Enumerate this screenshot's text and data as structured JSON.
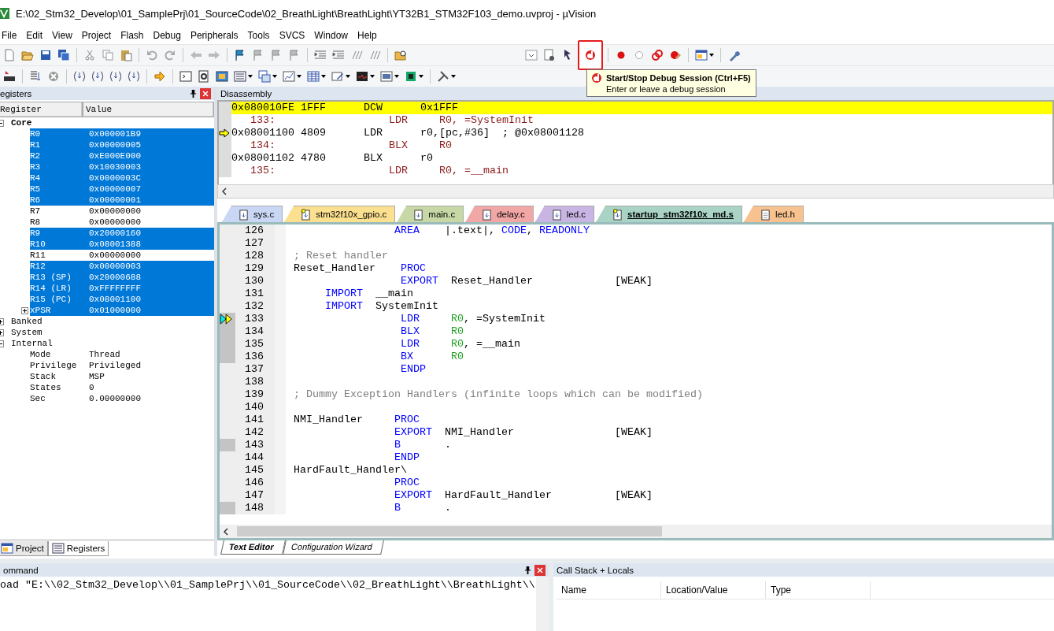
{
  "window": {
    "title": "E:\\02_Stm32_Develop\\01_SamplePrj\\01_SourceCode\\02_BreathLight\\BreathLight\\YT32B1_STM32F103_demo.uvproj - µVision"
  },
  "menu": [
    "File",
    "Edit",
    "View",
    "Project",
    "Flash",
    "Debug",
    "Peripherals",
    "Tools",
    "SVCS",
    "Window",
    "Help"
  ],
  "tooltip": {
    "title": "Start/Stop Debug Session (Ctrl+F5)",
    "text": "Enter or leave a debug session"
  },
  "registers": {
    "title": "egisters",
    "columns": [
      "Register",
      "Value"
    ],
    "tree": [
      {
        "name": "Core",
        "expanded": true,
        "children": [
          {
            "name": "R0",
            "value": "0x000001B9",
            "selected": true
          },
          {
            "name": "R1",
            "value": "0x00000005",
            "selected": true
          },
          {
            "name": "R2",
            "value": "0xE000E000",
            "selected": true
          },
          {
            "name": "R3",
            "value": "0x10030003",
            "selected": true
          },
          {
            "name": "R4",
            "value": "0x0000003C",
            "selected": true
          },
          {
            "name": "R5",
            "value": "0x00000007",
            "selected": true
          },
          {
            "name": "R6",
            "value": "0x00000001",
            "selected": true
          },
          {
            "name": "R7",
            "value": "0x00000000",
            "selected": false
          },
          {
            "name": "R8",
            "value": "0x00000000",
            "selected": false
          },
          {
            "name": "R9",
            "value": "0x20000160",
            "selected": true
          },
          {
            "name": "R10",
            "value": "0x08001388",
            "selected": true
          },
          {
            "name": "R11",
            "value": "0x00000000",
            "selected": false
          },
          {
            "name": "R12",
            "value": "0x00000003",
            "selected": true
          },
          {
            "name": "R13 (SP)",
            "value": "0x20000688",
            "selected": true
          },
          {
            "name": "R14 (LR)",
            "value": "0xFFFFFFFF",
            "selected": true
          },
          {
            "name": "R15 (PC)",
            "value": "0x08001100",
            "selected": true
          },
          {
            "name": "xPSR",
            "value": "0x01000000",
            "selected": true,
            "expanded": false
          }
        ]
      },
      {
        "name": "Banked",
        "expanded": false
      },
      {
        "name": "System",
        "expanded": false
      },
      {
        "name": "Internal",
        "expanded": true,
        "children": [
          {
            "name": "Mode",
            "value": "Thread",
            "selected": false
          },
          {
            "name": "Privilege",
            "value": "Privileged",
            "selected": false
          },
          {
            "name": "Stack",
            "value": "MSP",
            "selected": false
          },
          {
            "name": "States",
            "value": "0",
            "selected": false
          },
          {
            "name": "Sec",
            "value": "0.00000000",
            "selected": false
          }
        ]
      }
    ]
  },
  "left_tabs": [
    {
      "label": "Project",
      "selected": false
    },
    {
      "label": "Registers",
      "selected": true
    }
  ],
  "disassembly": {
    "title": "Disassembly",
    "rows": [
      {
        "kind": "instruction",
        "text": "0x080010FE 1FFF      DCW      0x1FFF",
        "highlighted": true,
        "current": false
      },
      {
        "kind": "source",
        "text": "   133:                  LDR     R0, =SystemInit",
        "highlighted": false,
        "current": false
      },
      {
        "kind": "instruction",
        "text": "0x08001100 4809      LDR      r0,[pc,#36]  ; @0x08001128",
        "highlighted": false,
        "current": true
      },
      {
        "kind": "source",
        "text": "   134:                  BLX     R0",
        "highlighted": false,
        "current": false
      },
      {
        "kind": "instruction",
        "text": "0x08001102 4780      BLX      r0",
        "highlighted": false,
        "current": false
      },
      {
        "kind": "source",
        "text": "   135:                  LDR     R0, =__main",
        "highlighted": false,
        "current": false
      }
    ]
  },
  "file_tabs": [
    {
      "label": "sys.c",
      "color": "#c9d7f4",
      "selected": false,
      "kind": "source"
    },
    {
      "label": "stm32f10x_gpio.c",
      "color": "#fbe08f",
      "selected": false,
      "kind": "library"
    },
    {
      "label": "main.c",
      "color": "#c7d8a6",
      "selected": false,
      "kind": "source"
    },
    {
      "label": "delay.c",
      "color": "#f2a7a7",
      "selected": false,
      "kind": "source"
    },
    {
      "label": "led.c",
      "color": "#c8b5e3",
      "selected": false,
      "kind": "source"
    },
    {
      "label": "startup_stm32f10x_md.s",
      "color": "#a9d4c5",
      "selected": true,
      "kind": "library"
    },
    {
      "label": "led.h",
      "color": "#f7c28f",
      "selected": false,
      "kind": "header"
    }
  ],
  "editor": {
    "lines": [
      {
        "number": "126",
        "executed": false,
        "current": false,
        "tokens": [
          {
            "kind": "keyword",
            "text": "                AREA"
          },
          {
            "kind": "text",
            "text": "    |.text|, "
          },
          {
            "kind": "keyword",
            "text": "CODE"
          },
          {
            "kind": "text",
            "text": ", "
          },
          {
            "kind": "keyword",
            "text": "READONLY"
          }
        ]
      },
      {
        "number": "127",
        "executed": false,
        "current": false
      },
      {
        "number": "128",
        "executed": false,
        "current": false,
        "tokens": [
          {
            "kind": "comment",
            "text": "; Reset handler"
          }
        ]
      },
      {
        "number": "129",
        "executed": false,
        "current": false,
        "tokens": [
          {
            "kind": "text",
            "text": "Reset_Handler    "
          },
          {
            "kind": "keyword",
            "text": "PROC"
          }
        ]
      },
      {
        "number": "130",
        "executed": false,
        "current": false,
        "tokens": [
          {
            "kind": "keyword",
            "text": "                 EXPORT"
          },
          {
            "kind": "text",
            "text": "  Reset_Handler             [WEAK]"
          }
        ]
      },
      {
        "number": "131",
        "executed": false,
        "current": false,
        "tokens": [
          {
            "kind": "keyword",
            "text": "     IMPORT"
          },
          {
            "kind": "text",
            "text": "  __main"
          }
        ]
      },
      {
        "number": "132",
        "executed": false,
        "current": false,
        "tokens": [
          {
            "kind": "keyword",
            "text": "     IMPORT"
          },
          {
            "kind": "text",
            "text": "  SystemInit"
          }
        ]
      },
      {
        "number": "133",
        "executed": true,
        "current": true,
        "tokens": [
          {
            "kind": "keyword",
            "text": "                 LDR"
          },
          {
            "kind": "register",
            "text": "     R0"
          },
          {
            "kind": "text",
            "text": ", =SystemInit"
          }
        ]
      },
      {
        "number": "134",
        "executed": true,
        "current": false,
        "tokens": [
          {
            "kind": "keyword",
            "text": "                 BLX"
          },
          {
            "kind": "register",
            "text": "     R0"
          }
        ]
      },
      {
        "number": "135",
        "executed": true,
        "current": false,
        "tokens": [
          {
            "kind": "keyword",
            "text": "                 LDR"
          },
          {
            "kind": "register",
            "text": "     R0"
          },
          {
            "kind": "text",
            "text": ", =__main"
          }
        ]
      },
      {
        "number": "136",
        "executed": true,
        "current": false,
        "tokens": [
          {
            "kind": "keyword",
            "text": "                 BX"
          },
          {
            "kind": "register",
            "text": "      R0"
          }
        ]
      },
      {
        "number": "137",
        "executed": false,
        "current": false,
        "tokens": [
          {
            "kind": "keyword",
            "text": "                 ENDP"
          }
        ]
      },
      {
        "number": "138",
        "executed": false,
        "current": false
      },
      {
        "number": "139",
        "executed": false,
        "current": false,
        "tokens": [
          {
            "kind": "comment",
            "text": "; Dummy Exception Handlers (infinite loops which can be modified)"
          }
        ]
      },
      {
        "number": "140",
        "executed": false,
        "current": false
      },
      {
        "number": "141",
        "executed": false,
        "current": false,
        "tokens": [
          {
            "kind": "text",
            "text": "NMI_Handler     "
          },
          {
            "kind": "keyword",
            "text": "PROC"
          }
        ]
      },
      {
        "number": "142",
        "executed": false,
        "current": false,
        "tokens": [
          {
            "kind": "keyword",
            "text": "                EXPORT"
          },
          {
            "kind": "text",
            "text": "  NMI_Handler                [WEAK]"
          }
        ]
      },
      {
        "number": "143",
        "executed": true,
        "current": false,
        "tokens": [
          {
            "kind": "keyword",
            "text": "                B"
          },
          {
            "kind": "text",
            "text": "       ."
          }
        ]
      },
      {
        "number": "144",
        "executed": false,
        "current": false,
        "tokens": [
          {
            "kind": "keyword",
            "text": "                ENDP"
          }
        ]
      },
      {
        "number": "145",
        "executed": false,
        "current": false,
        "tokens": [
          {
            "kind": "text",
            "text": "HardFault_Handler\\"
          }
        ]
      },
      {
        "number": "146",
        "executed": false,
        "current": false,
        "tokens": [
          {
            "kind": "keyword",
            "text": "                PROC"
          }
        ]
      },
      {
        "number": "147",
        "executed": false,
        "current": false,
        "tokens": [
          {
            "kind": "keyword",
            "text": "                EXPORT"
          },
          {
            "kind": "text",
            "text": "  HardFault_Handler          [WEAK]"
          }
        ]
      },
      {
        "number": "148",
        "executed": true,
        "current": false,
        "tokens": [
          {
            "kind": "keyword",
            "text": "                B"
          },
          {
            "kind": "text",
            "text": "       ."
          }
        ]
      }
    ]
  },
  "editor_tabs": [
    {
      "label": "Text Editor",
      "selected": true
    },
    {
      "label": "Configuration Wizard",
      "selected": false
    }
  ],
  "command": {
    "title": "ommand",
    "text": "oad \"E:\\\\02_Stm32_Develop\\\\01_SamplePrj\\\\01_SourceCode\\\\02_BreathLight\\\\BreathLight\\\\"
  },
  "call_stack": {
    "title": "Call Stack + Locals",
    "columns": [
      "Name",
      "Location/Value",
      "Type"
    ]
  }
}
